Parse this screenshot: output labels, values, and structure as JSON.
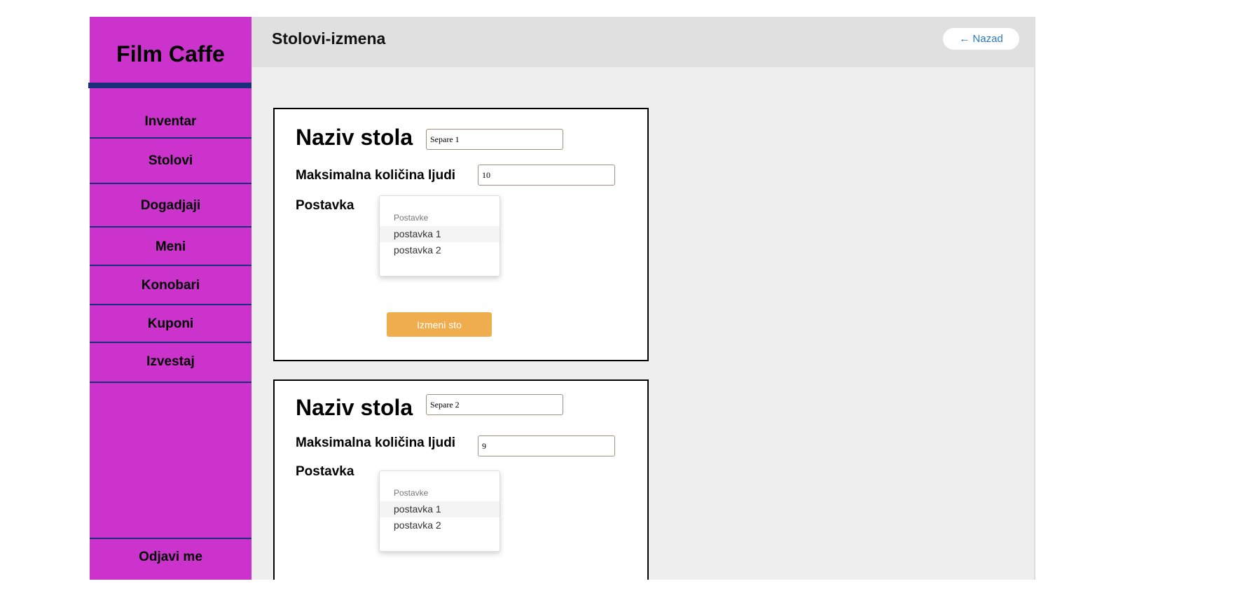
{
  "sidebar": {
    "brand": "Film Caffe",
    "items": [
      {
        "label": "Inventar"
      },
      {
        "label": "Stolovi"
      },
      {
        "label": "Dogadjaji"
      },
      {
        "label": "Meni"
      },
      {
        "label": "Konobari"
      },
      {
        "label": "Kuponi"
      },
      {
        "label": "Izvestaj"
      }
    ],
    "logout": "Odjavi me"
  },
  "header": {
    "title": "Stolovi-izmena",
    "back_label": "← Nazad"
  },
  "cards": [
    {
      "name_label": "Naziv stola",
      "name_value": "Separe 1",
      "max_label": "Maksimalna količina ljudi",
      "max_value": "10",
      "postavka_label": "Postavka",
      "dropdown_header": "Postavke",
      "options": [
        "postavka 1",
        "postavka 2"
      ],
      "submit_label": "Izmeni sto"
    },
    {
      "name_label": "Naziv stola",
      "name_value": "Separe 2",
      "max_label": "Maksimalna količina ljudi",
      "max_value": "9",
      "postavka_label": "Postavka",
      "dropdown_header": "Postavke",
      "options": [
        "postavka 1",
        "postavka 2"
      ]
    }
  ],
  "colors": {
    "sidebar": "#cc33cc",
    "accent_bar": "#1a2f7a",
    "button": "#f0ad4e",
    "link": "#2a7ac0"
  }
}
